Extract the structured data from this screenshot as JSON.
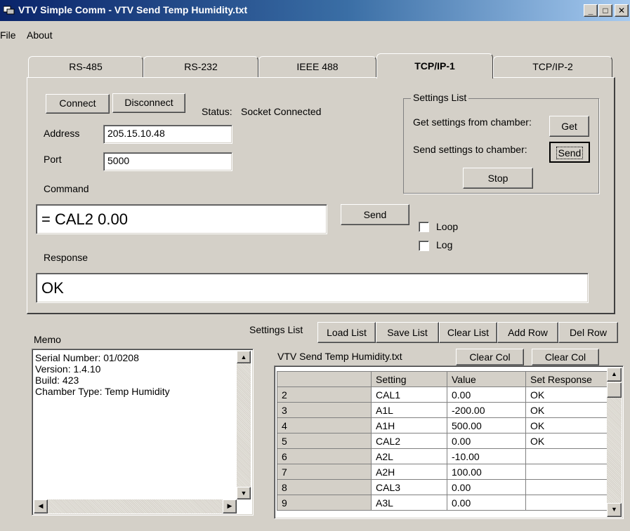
{
  "window": {
    "title": "VTV Simple Comm - VTV Send Temp Humidity.txt"
  },
  "menu": {
    "file": "File",
    "about": "About"
  },
  "tabs": [
    "RS-485",
    "RS-232",
    "IEEE 488",
    "TCP/IP-1",
    "TCP/IP-2"
  ],
  "active_tab": "TCP/IP-1",
  "connection": {
    "connect_label": "Connect",
    "disconnect_label": "Disconnect",
    "status_label": "Status:",
    "status_value": "Socket Connected",
    "address_label": "Address",
    "address_value": "205.15.10.48",
    "port_label": "Port",
    "port_value": "5000"
  },
  "settings_group": {
    "title": "Settings List",
    "get_label": "Get settings from chamber:",
    "get_button": "Get",
    "send_label": "Send settings to chamber:",
    "send_button": "Send",
    "stop_button": "Stop"
  },
  "command": {
    "label": "Command",
    "value": "= CAL2 0.00",
    "send_button": "Send",
    "loop_label": "Loop",
    "loop_checked": false,
    "log_label": "Log",
    "log_checked": false
  },
  "response": {
    "label": "Response",
    "value": "OK"
  },
  "memo": {
    "label": "Memo",
    "lines": [
      "Serial Number: 01/0208",
      "Version: 1.4.10",
      "Build: 423",
      "Chamber Type: Temp Humidity"
    ]
  },
  "settings_toolbar": {
    "label": "Settings List",
    "load": "Load List",
    "save": "Save List",
    "clear": "Clear List",
    "add_row": "Add Row",
    "del_row": "Del Row"
  },
  "grid_header": {
    "filename": "VTV Send Temp Humidity.txt",
    "clear_col_1": "Clear Col",
    "clear_col_2": "Clear Col"
  },
  "grid": {
    "columns": [
      "",
      "Setting",
      "Value",
      "Set Response"
    ],
    "rows": [
      [
        "2",
        "CAL1",
        "0.00",
        "OK"
      ],
      [
        "3",
        "A1L",
        "-200.00",
        "OK"
      ],
      [
        "4",
        "A1H",
        "500.00",
        "OK"
      ],
      [
        "5",
        "CAL2",
        "0.00",
        "OK"
      ],
      [
        "6",
        "A2L",
        "-10.00",
        ""
      ],
      [
        "7",
        "A2H",
        "100.00",
        ""
      ],
      [
        "8",
        "CAL3",
        "0.00",
        ""
      ],
      [
        "9",
        "A3L",
        "0.00",
        ""
      ]
    ]
  },
  "icons": {
    "app": "app-icon",
    "minimize": "minimize-icon",
    "maximize": "maximize-icon",
    "close": "close-icon"
  },
  "colors": {
    "titlebar_start": "#0a246a",
    "titlebar_end": "#a6caf0",
    "face": "#d4d0c8"
  }
}
